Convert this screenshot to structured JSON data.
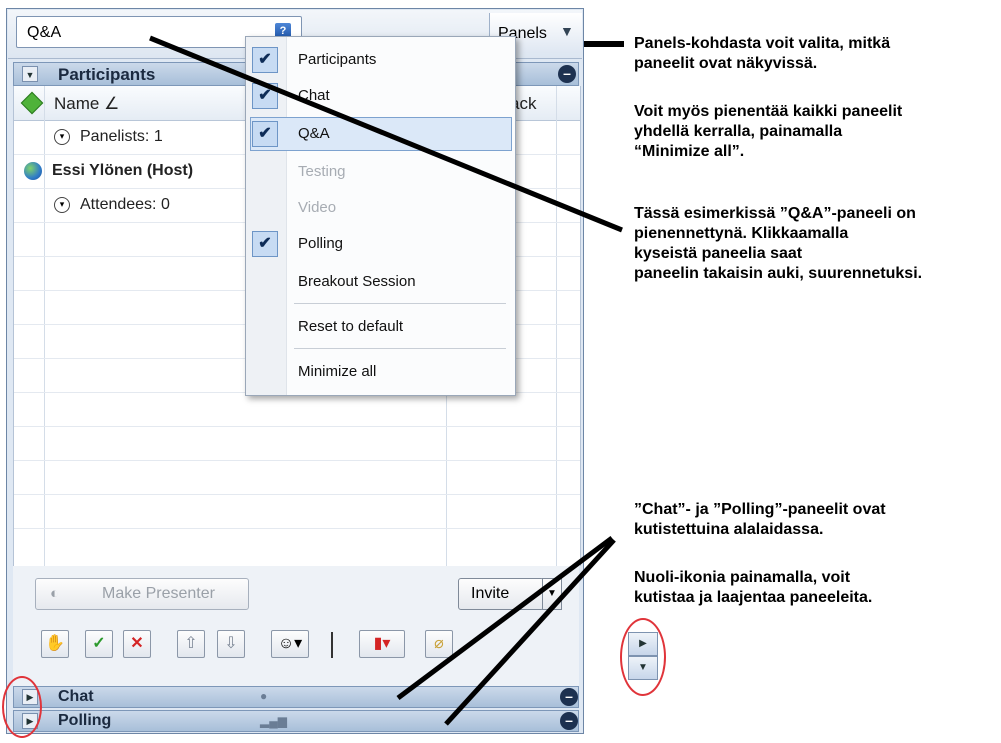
{
  "topbar": {
    "qa_label": "Q&A",
    "panels_label": "Panels"
  },
  "participants": {
    "title": "Participants",
    "column_name": "Name",
    "column_ack": "ack",
    "rows": [
      "Panelists: 1",
      "Essi Ylönen (Host)",
      "Attendees: 0"
    ]
  },
  "buttons": {
    "make_presenter": "Make Presenter",
    "invite": "Invite"
  },
  "collapsed_panels": [
    "Chat",
    "Polling"
  ],
  "menu": {
    "items": [
      {
        "label": "Participants",
        "checked": true
      },
      {
        "label": "Chat",
        "checked": true
      },
      {
        "label": "Q&A",
        "checked": true
      },
      {
        "label": "Testing",
        "checked": false
      },
      {
        "label": "Video",
        "checked": false
      },
      {
        "label": "Polling",
        "checked": true
      },
      {
        "label": "Breakout Session",
        "checked": false
      },
      {
        "label": "Reset to default",
        "checked": false
      },
      {
        "label": "Minimize all",
        "checked": false
      }
    ]
  },
  "annotations": {
    "panels": "Panels-kohdasta voit valita, mitkä\npaneelit ovat näkyvissä.",
    "minimize": "Voit myös pienentää kaikki paneelit\nyhdellä kerralla, painamalla\n“Minimize all”.",
    "qa_example": "Tässä esimerkissä ”Q&A”-paneeli on\npienennettynä. Klikkaamalla\nkyseistä paneelia saat\npaneelin takaisin auki, suurennetuksi.",
    "collapsed": "”Chat”- ja ”Polling”-paneelit ovat\nkutistettuina alalaidassa.",
    "arrows": "Nuoli-ikonia painamalla, voit\nkutistaa ja laajentaa paneeleita."
  },
  "colors": {
    "accent": "#1f55a8",
    "ring": "#e0343a"
  },
  "icons": [
    "help-icon",
    "chevron-down-icon",
    "diamond-icon",
    "expand-circle-icon",
    "globe-icon",
    "hand-icon",
    "check-icon",
    "cross-icon",
    "chart-icon",
    "speech-bubble-icon",
    "bar-chart-icon",
    "expand-arrow-icon",
    "collapse-arrow-icon"
  ]
}
